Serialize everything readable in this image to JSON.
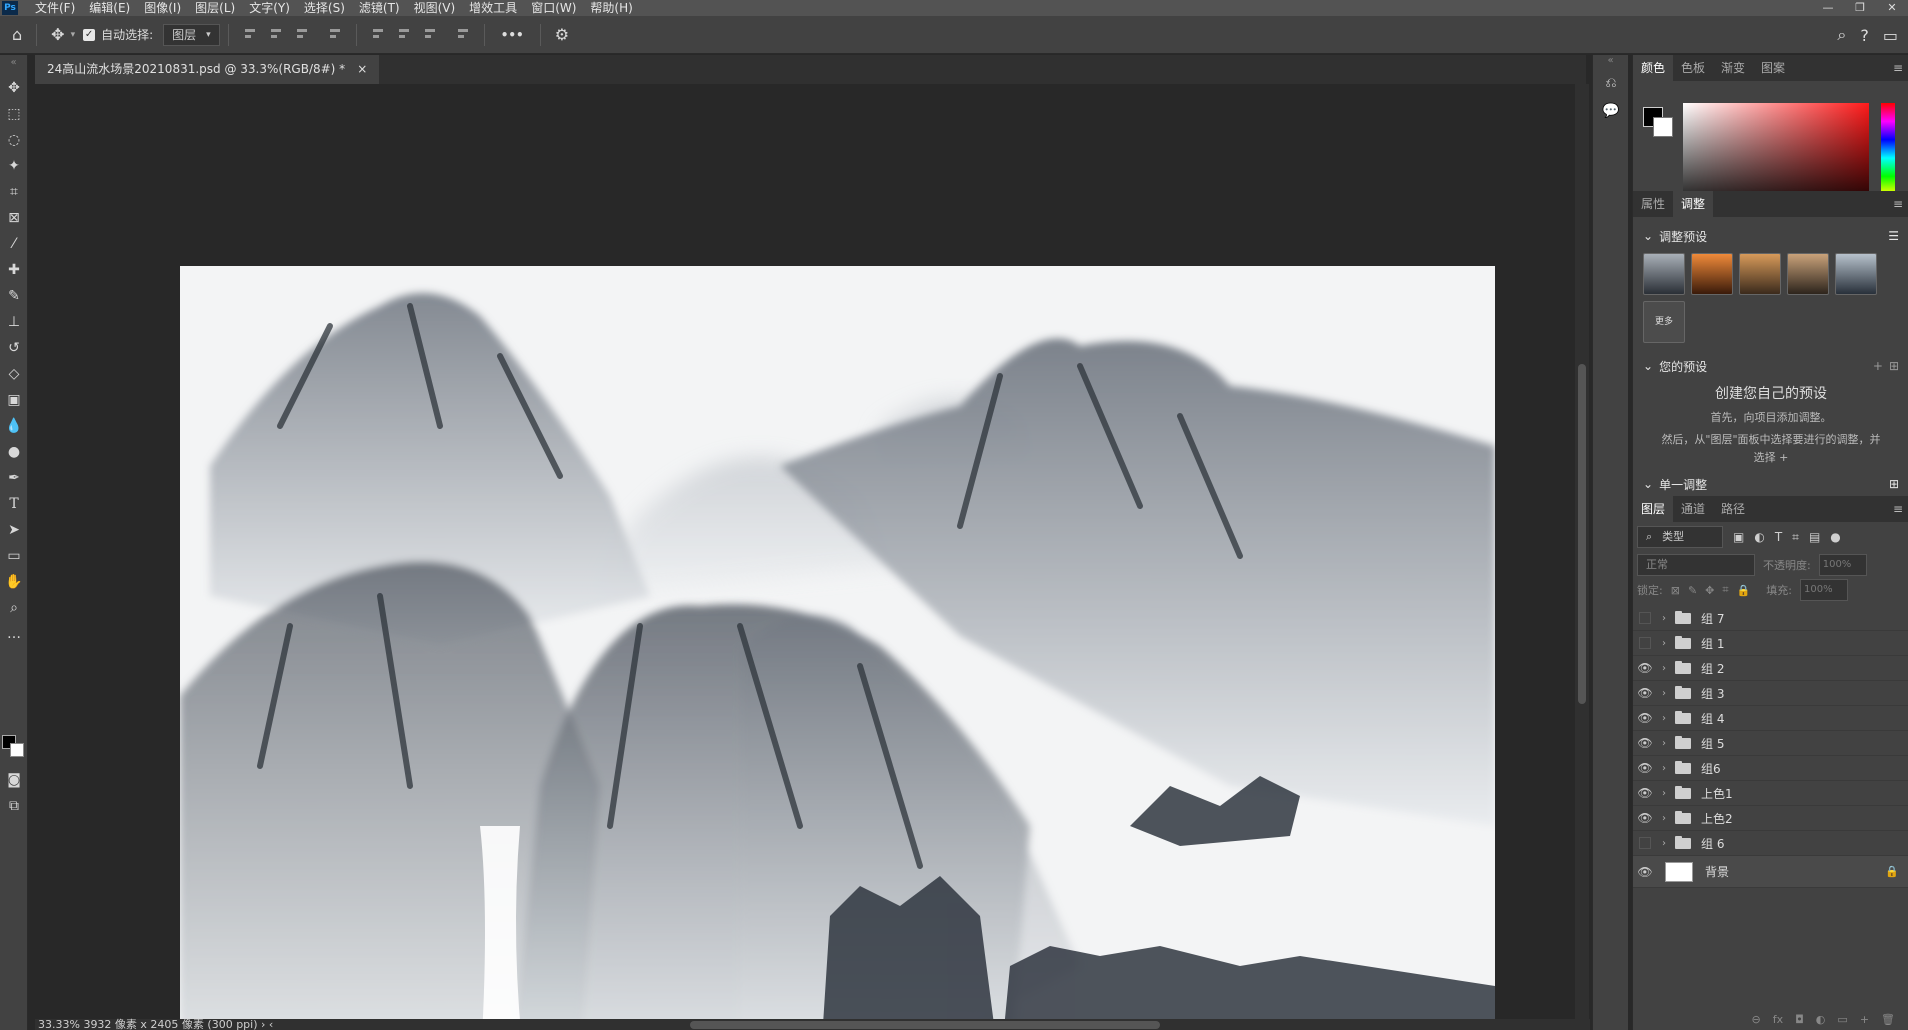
{
  "app": {
    "logo": "Ps"
  },
  "menu": [
    "文件(F)",
    "编辑(E)",
    "图像(I)",
    "图层(L)",
    "文字(Y)",
    "选择(S)",
    "滤镜(T)",
    "视图(V)",
    "增效工具",
    "窗口(W)",
    "帮助(H)"
  ],
  "window_controls": [
    "—",
    "❐",
    "✕"
  ],
  "options": {
    "auto_select_label": "自动选择:",
    "auto_select_checked": "✓",
    "select_value": "图层",
    "more": "•••"
  },
  "document": {
    "tab_title": "24高山流水场景20210831.psd @ 33.3%(RGB/8#) *",
    "close": "×"
  },
  "status": {
    "text": "33.33%  3932 像素 x 2405 像素 (300 ppi)  ›  ‹"
  },
  "color_panel": {
    "tabs": [
      "颜色",
      "色板",
      "渐变",
      "图案"
    ],
    "fg_color": "#000000",
    "bg_color": "#ffffff"
  },
  "adjust_panel": {
    "tabs": [
      "属性",
      "调整"
    ],
    "presets_title": "调整预设",
    "more_label": "更多",
    "your_presets": "您的预设",
    "create_title": "创建您自己的预设",
    "create_line1": "首先，向项目添加调整。",
    "create_line2": "然后，从\"图层\"面板中选择要进行的调整，并",
    "create_line3": "选择 +",
    "single_adjust": "单一调整"
  },
  "layers_panel": {
    "tabs": [
      "图层",
      "通道",
      "路径"
    ],
    "filter_value": "类型",
    "blend_mode": "正常",
    "opacity_label": "不透明度:",
    "opacity_value": "100%",
    "lock_label": "锁定:",
    "fill_label": "填充:",
    "fill_value": "100%",
    "layers": [
      {
        "name": "组 7",
        "visible": false
      },
      {
        "name": "组 1",
        "visible": false
      },
      {
        "name": "组 2",
        "visible": true
      },
      {
        "name": "组 3",
        "visible": true
      },
      {
        "name": "组 4",
        "visible": true
      },
      {
        "name": "组 5",
        "visible": true
      },
      {
        "name": "组6",
        "visible": true
      },
      {
        "name": "上色1",
        "visible": true
      },
      {
        "name": "上色2",
        "visible": true
      },
      {
        "name": "组 6",
        "visible": false
      }
    ],
    "background_layer": "背景",
    "bottom_icons": [
      "⊖",
      "fx",
      "◘",
      "◐",
      "▭",
      "+",
      "🗑"
    ]
  }
}
